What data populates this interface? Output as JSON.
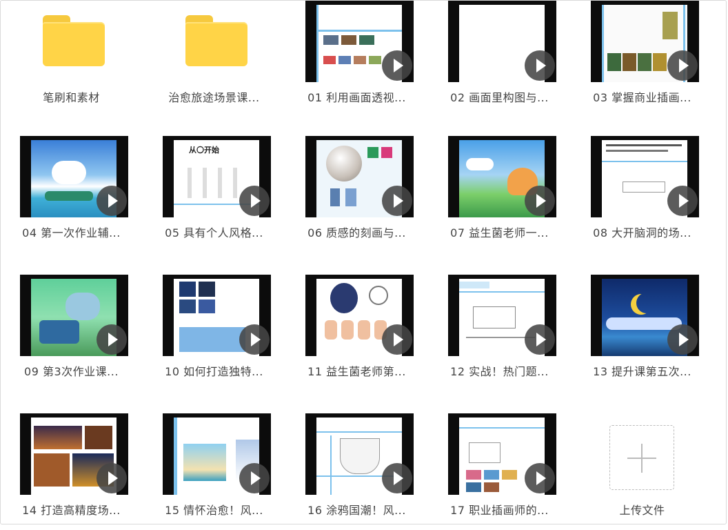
{
  "items": [
    {
      "type": "folder",
      "label": "笔刷和素材"
    },
    {
      "type": "folder",
      "label": "治愈旅途场景课..."
    },
    {
      "type": "video",
      "label": "01 利用画面透视..."
    },
    {
      "type": "video",
      "label": "02 画面里构图与..."
    },
    {
      "type": "video",
      "label": "03 掌握商业插画..."
    },
    {
      "type": "video",
      "label": "04 第一次作业辅..."
    },
    {
      "type": "video",
      "label": "05 具有个人风格..."
    },
    {
      "type": "video",
      "label": "06 质感的刻画与..."
    },
    {
      "type": "video",
      "label": "07 益生菌老师一..."
    },
    {
      "type": "video",
      "label": "08 大开脑洞的场..."
    },
    {
      "type": "video",
      "label": "09 第3次作业课..."
    },
    {
      "type": "video",
      "label": "10 如何打造独特..."
    },
    {
      "type": "video",
      "label": "11 益生菌老师第..."
    },
    {
      "type": "video",
      "label": "12 实战！热门题..."
    },
    {
      "type": "video",
      "label": "13 提升课第五次..."
    },
    {
      "type": "video",
      "label": "14 打造高精度场..."
    },
    {
      "type": "video",
      "label": "15 情怀治愈！风..."
    },
    {
      "type": "video",
      "label": "16 涂鸦国潮！风..."
    },
    {
      "type": "video",
      "label": "17 职业插画师的..."
    },
    {
      "type": "upload",
      "label": "上传文件"
    }
  ],
  "thumb_text": {
    "t05_title": "从〇开始"
  },
  "colors": {
    "folder": "#ffd447",
    "label": "#444444",
    "play_overlay": "#464646"
  }
}
